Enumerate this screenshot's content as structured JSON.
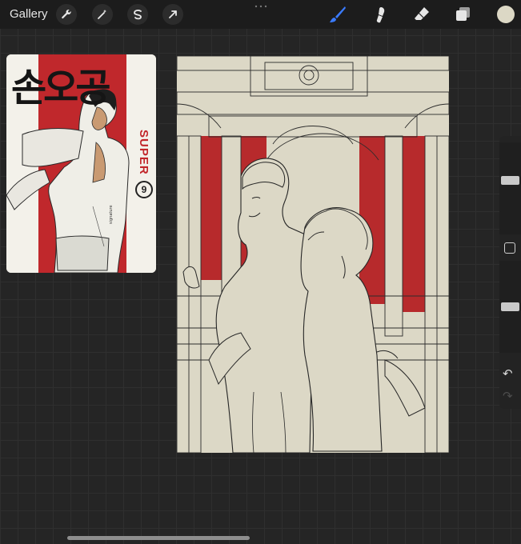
{
  "toolbar": {
    "gallery_label": "Gallery",
    "left_buttons": [
      "wrench-icon",
      "magic-wand-icon",
      "selection-icon",
      "transform-arrow-icon"
    ],
    "right_tools": [
      "brush-icon",
      "smudge-icon",
      "eraser-icon",
      "layers-icon"
    ],
    "active_tool": "brush",
    "active_color": "#dcd8c5",
    "accent": "#3a7bff"
  },
  "reference": {
    "title": "손오공",
    "vertical_text_accent": "SUPER",
    "volume": "9"
  },
  "sidebar": {
    "brush_size_level": 0.6,
    "opacity_level": 0.5,
    "buttons": [
      "modify-square-icon",
      "undo-icon",
      "redo-icon"
    ],
    "undo_glyph": "↶",
    "redo_glyph": "↷"
  }
}
